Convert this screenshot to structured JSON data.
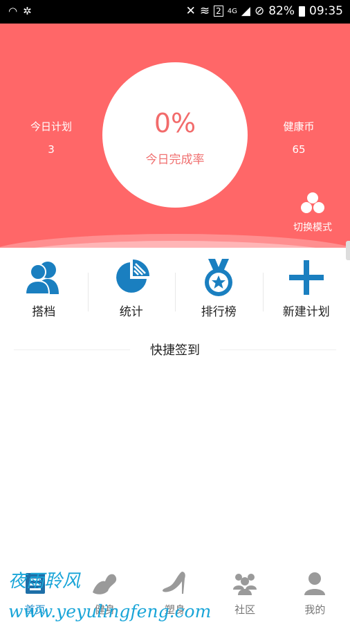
{
  "status_bar": {
    "left_icons": [
      "hotspot-icon",
      "bluetooth-icon"
    ],
    "network_badge": "2",
    "network_type": "4G",
    "battery": "82%",
    "time": "09:35"
  },
  "header": {
    "today_plan_label": "今日计划",
    "today_plan_value": "3",
    "completion_value": "0%",
    "completion_label": "今日完成率",
    "coins_label": "健康币",
    "coins_value": "65",
    "switch_mode_label": "切换模式",
    "colors": {
      "background": "#ff6768",
      "accent_text": "#f26b6b"
    }
  },
  "actions": [
    {
      "label": "搭档",
      "icon": "partner-icon"
    },
    {
      "label": "统计",
      "icon": "pie-chart-icon"
    },
    {
      "label": "排行榜",
      "icon": "medal-icon"
    },
    {
      "label": "新建计划",
      "icon": "plus-icon"
    }
  ],
  "section": {
    "title": "快捷签到"
  },
  "nav": {
    "items": [
      {
        "label": "首页",
        "icon": "home-icon",
        "active": true
      },
      {
        "label": "健身",
        "icon": "muscle-icon"
      },
      {
        "label": "塑身",
        "icon": "heel-icon"
      },
      {
        "label": "社区",
        "icon": "community-icon"
      },
      {
        "label": "我的",
        "icon": "profile-icon"
      }
    ],
    "active_color": "#1a8ac8"
  },
  "watermark": {
    "line1": "夜雨聆风",
    "line2": "www.yeyulingfeng.com"
  }
}
